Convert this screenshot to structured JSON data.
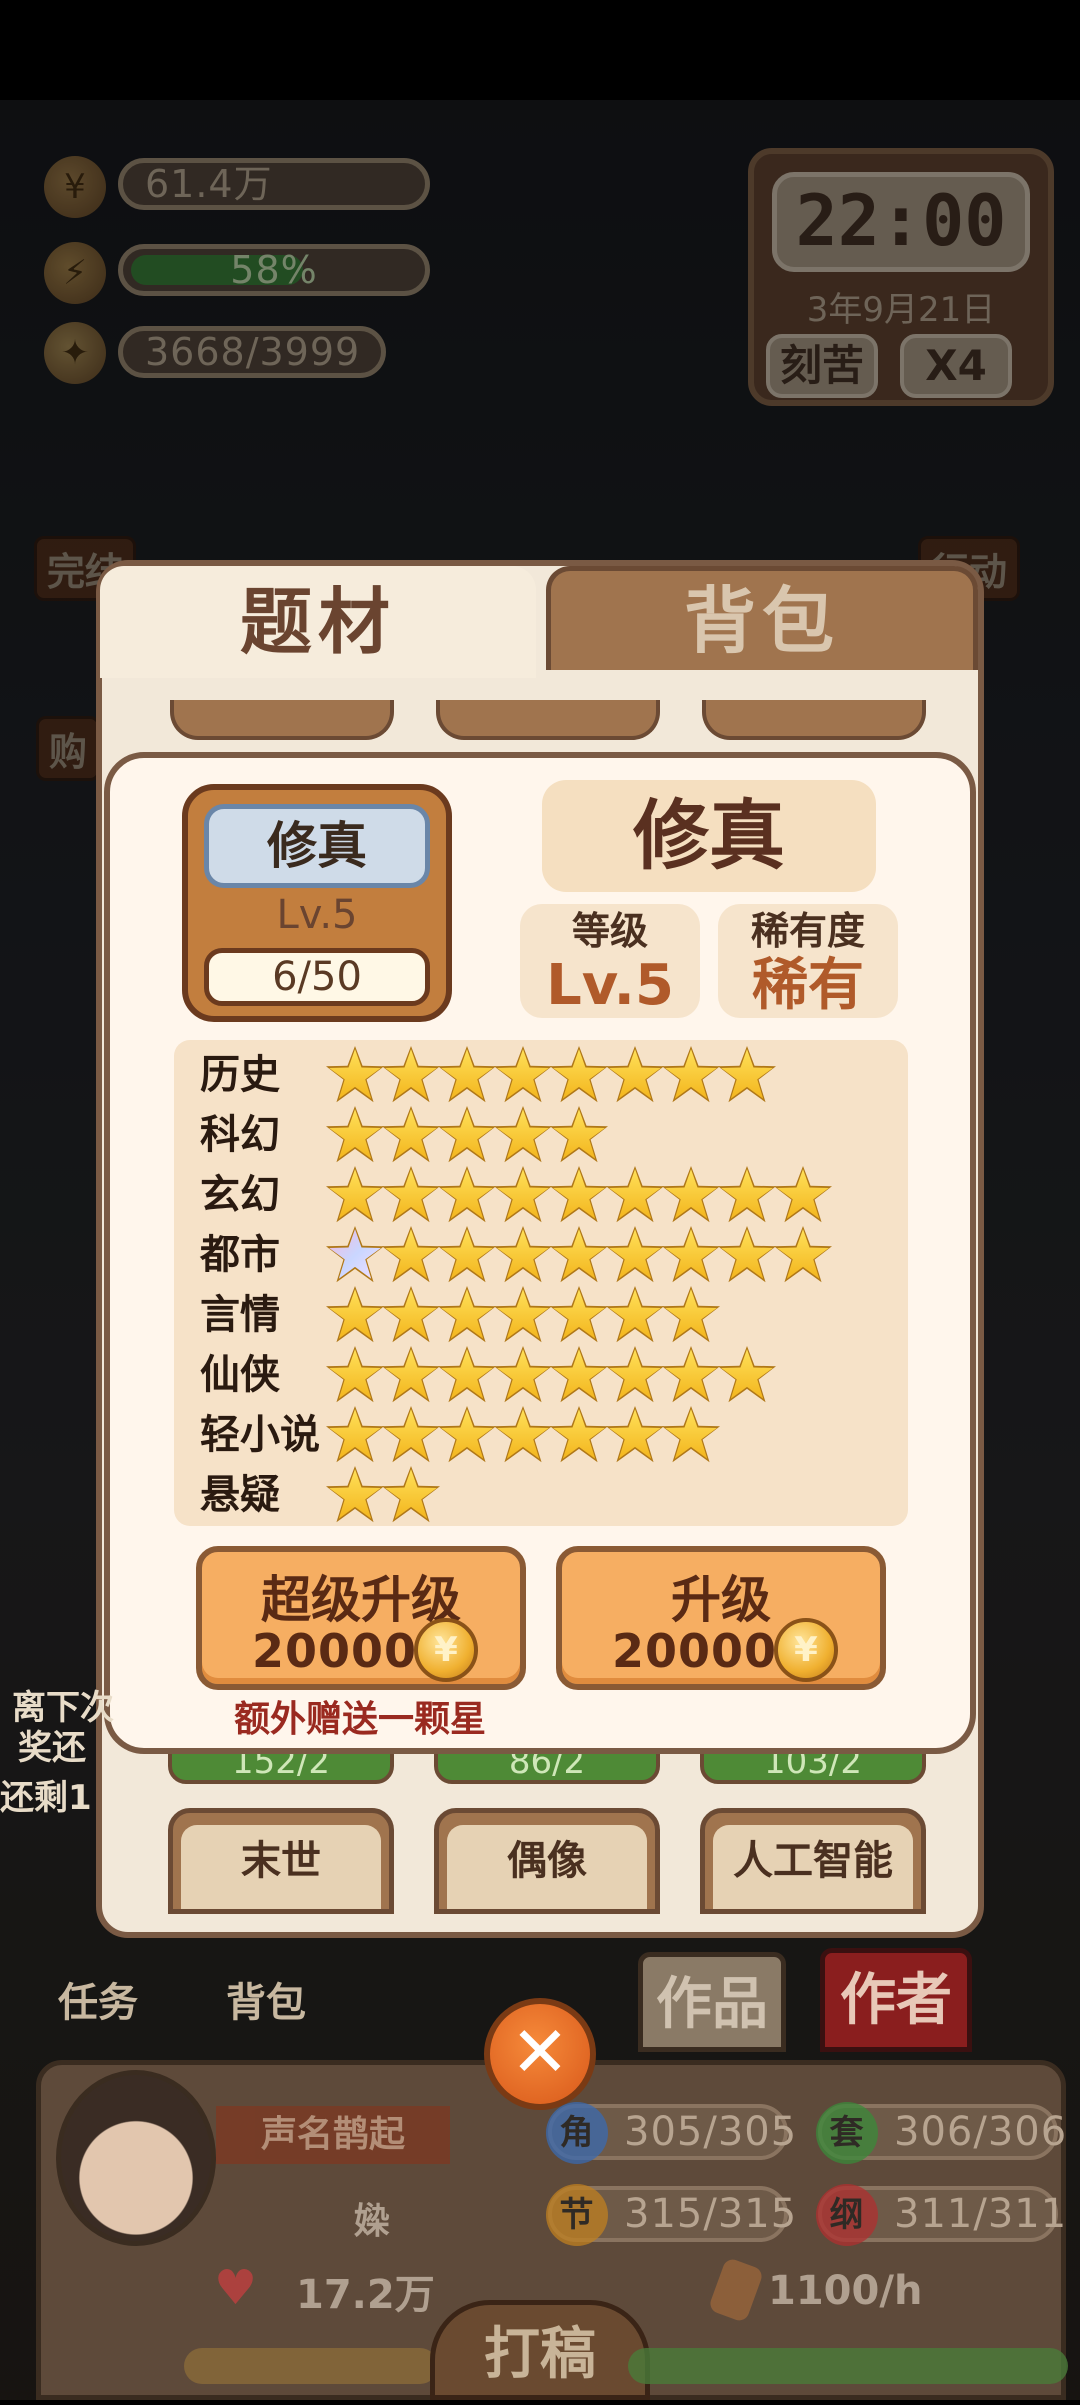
{
  "resources": {
    "money": "61.4万",
    "energy": "58%",
    "energy_level": 0.58,
    "inspiration": "3668/3999"
  },
  "clock": {
    "time": "22:00",
    "date": "3年9月21日",
    "mode": "刻苦",
    "speed": "X4"
  },
  "side": {
    "left_top": "完结",
    "right_top": "行动",
    "left_mid": "购"
  },
  "tabs": {
    "active": "题材",
    "inactive": "背包"
  },
  "grid": {
    "partial_labels": [
      "152/2",
      "86/2",
      "103/2"
    ],
    "bottom_cards": [
      "末世",
      "偶像",
      "人工智能"
    ]
  },
  "detail": {
    "card_name": "修真",
    "card_level": "Lv.5",
    "card_count": "6/50",
    "title": "修真",
    "level_header": "等级",
    "level_value": "Lv.5",
    "rarity_header": "稀有度",
    "rarity_value": "稀有",
    "star_rows": [
      {
        "label": "历史",
        "stars": 8,
        "special": 0
      },
      {
        "label": "科幻",
        "stars": 5,
        "special": 0
      },
      {
        "label": "玄幻",
        "stars": 9,
        "special": 0
      },
      {
        "label": "都市",
        "stars": 9,
        "special": 1
      },
      {
        "label": "言情",
        "stars": 7,
        "special": 0
      },
      {
        "label": "仙侠",
        "stars": 8,
        "special": 0
      },
      {
        "label": "轻小说",
        "stars": 7,
        "special": 0
      },
      {
        "label": "悬疑",
        "stars": 2,
        "special": 0
      }
    ],
    "super_upgrade": {
      "label": "超级升级",
      "cost": "20000"
    },
    "upgrade": {
      "label": "升级",
      "cost": "20000"
    },
    "bonus_note": "额外赠送一颗星"
  },
  "left_notes": [
    "离下次",
    "奖还",
    "还剩1"
  ],
  "bottom_nav": {
    "task": "任务",
    "bag": "背包",
    "works": "作品",
    "author": "作者"
  },
  "author_panel": {
    "title": "声名鹊起",
    "name": "媣",
    "likes": "17.2万",
    "stat1_icon": "角",
    "stat1": "305/305",
    "stat2_icon": "套",
    "stat2": "306/306",
    "stat3_icon": "节",
    "stat3": "315/315",
    "stat4_icon": "纲",
    "stat4": "311/311",
    "rate": "1100/h",
    "write": "打稿"
  },
  "colors": {
    "accent": "#f6ae62",
    "panel": "#fff6ec",
    "frame": "#7a5a44",
    "stars": "#f2b31a"
  }
}
